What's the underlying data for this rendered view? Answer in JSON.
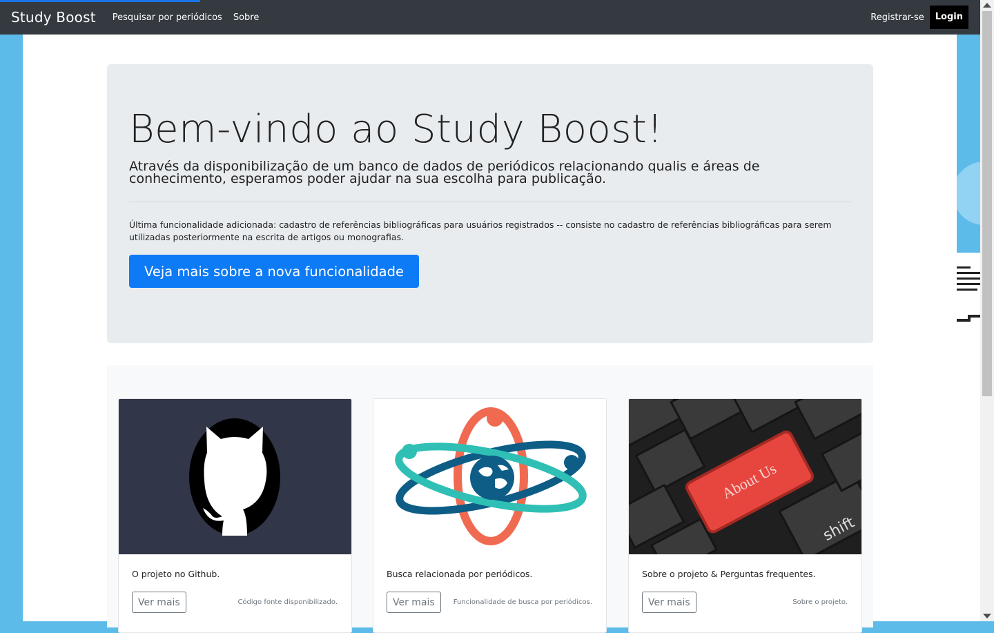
{
  "navbar": {
    "brand": "Study Boost",
    "links": [
      "Pesquisar por periódicos",
      "Sobre"
    ],
    "register": "Registrar-se",
    "login": "Login"
  },
  "jumbotron": {
    "title": "Bem-vindo ao Study Boost!",
    "lead": "Através da disponibilização de um banco de dados de periódicos relacionando qualis e áreas de conhecimento, esperamos poder ajudar na sua escolha para publicação.",
    "text": "Última funcionalidade adicionada: cadastro de referências bibliográficas para usuários registrados -- consiste no cadastro de referências bibliográficas para serem utilizadas posteriormente na escrita de artigos ou monografias.",
    "button": "Veja mais sobre a nova funcionalidade"
  },
  "cards": [
    {
      "icon": "github-octocat-icon",
      "text": "O projeto no Github.",
      "button": "Ver mais",
      "muted": "Código fonte disponibilizado."
    },
    {
      "icon": "atom-globe-icon",
      "text": "Busca relacionada por periódicos.",
      "button": "Ver mais",
      "muted": "Funcionalidade de busca por periódicos."
    },
    {
      "icon": "about-us-keyboard-icon",
      "text": "Sobre o projeto & Perguntas frequentes.",
      "button": "Ver mais",
      "muted": "Sobre o projeto.",
      "key_label": "About Us",
      "shift_label": "shift"
    }
  ],
  "colors": {
    "navbar": "#343a40",
    "primary": "#0d7bf6",
    "background": "#5dbbea"
  }
}
